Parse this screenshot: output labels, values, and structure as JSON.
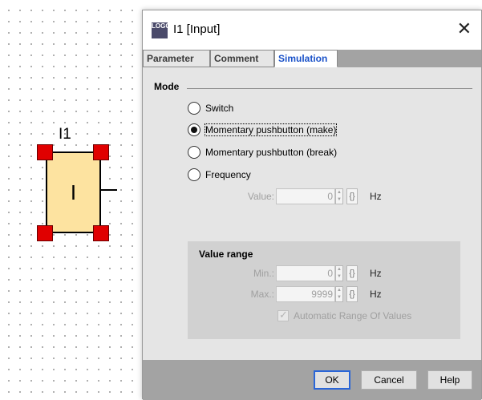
{
  "canvas": {
    "block_label": "I1",
    "block_glyph": "I"
  },
  "dialog": {
    "app_icon_text": "LOGO",
    "title": "I1 [Input]",
    "close_glyph": "✕",
    "tabs": [
      {
        "label": "Parameter",
        "active": false
      },
      {
        "label": "Comment",
        "active": false
      },
      {
        "label": "Simulation",
        "active": true
      }
    ],
    "mode": {
      "heading": "Mode",
      "options": [
        {
          "label": "Switch",
          "checked": false
        },
        {
          "label": "Momentary pushbutton (make)",
          "checked": true
        },
        {
          "label": "Momentary pushbutton (break)",
          "checked": false
        },
        {
          "label": "Frequency",
          "checked": false
        }
      ],
      "value_label": "Value:",
      "value": "0",
      "value_unit": "Hz"
    },
    "value_range": {
      "title": "Value range",
      "min_label": "Min.:",
      "min_value": "0",
      "max_label": "Max.:",
      "max_value": "9999",
      "unit": "Hz",
      "auto_label": "Automatic Range Of Values",
      "auto_checked": true
    },
    "buttons": {
      "ok": "OK",
      "cancel": "Cancel",
      "help": "Help"
    },
    "brace_glyph": "{}",
    "spin_up": "▲",
    "spin_down": "▼"
  }
}
